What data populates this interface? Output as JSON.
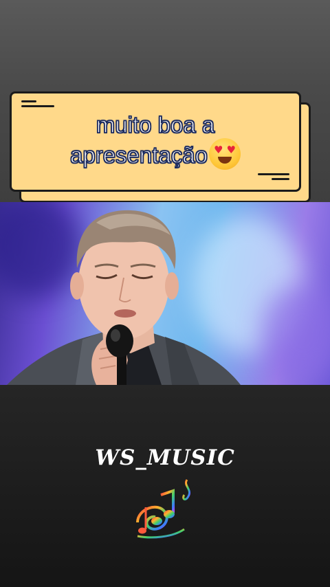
{
  "comment": {
    "line1": "muito boa a",
    "line2": "apresentação",
    "emoji": "heart-eyes-emoji"
  },
  "video": {
    "subject": "singer-with-microphone"
  },
  "watermark": {
    "brand": "WS_MUSIC",
    "icon": "music-notes-icon"
  },
  "colors": {
    "card_bg": "#ffd98a",
    "card_border": "#1b1b1b",
    "text_outline": "#1c2b5e"
  }
}
